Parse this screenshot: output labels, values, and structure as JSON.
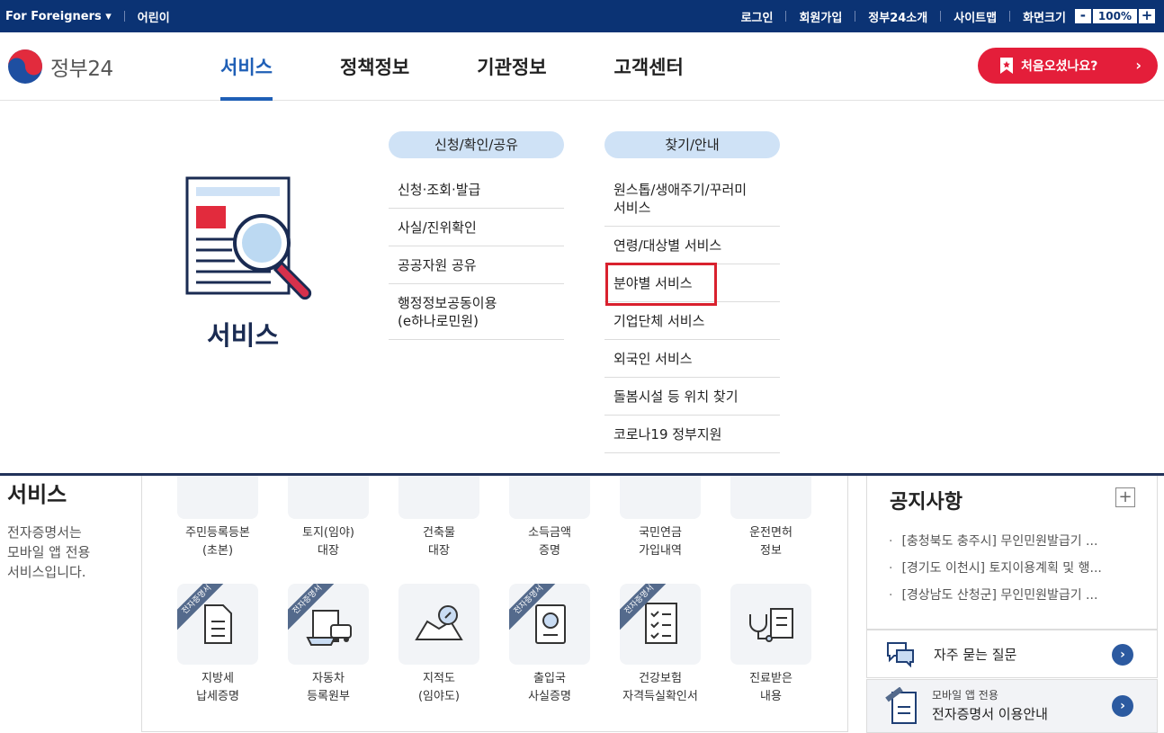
{
  "topbar": {
    "for_foreigners": "For Foreigners ▾",
    "kids": "어린이",
    "login": "로그인",
    "signup": "회원가입",
    "about": "정부24소개",
    "sitemap": "사이트맵",
    "zoom_label": "화면크기",
    "zoom_minus": "-",
    "zoom_value": "100%",
    "zoom_plus": "+"
  },
  "header": {
    "logo_text": "정부24",
    "nav": [
      "서비스",
      "정책정보",
      "기관정보",
      "고객센터"
    ],
    "first_visit": "처음오셨나요?",
    "first_visit_arrow": "›"
  },
  "dropdown": {
    "title": "서비스",
    "col1": {
      "heading": "신청/확인/공유",
      "items": [
        "신청·조회·발급",
        "사실/진위확인",
        "공공자원 공유",
        "행정정보공동이용\n(e하나로민원)"
      ]
    },
    "col2": {
      "heading": "찾기/안내",
      "items": [
        "원스톱/생애주기/꾸러미\n서비스",
        "연령/대상별 서비스",
        "분야별 서비스",
        "기업단체 서비스",
        "외국인 서비스",
        "돌봄시설 등 위치 찾기",
        "코로나19 정부지원"
      ]
    }
  },
  "side": {
    "title": "서비스",
    "desc": "전자증명서는\n모바일 앱 전용\n서비스입니다."
  },
  "grid": {
    "ribbon": "전자증명서",
    "row1": [
      "주민등록등본\n(초본)",
      "토지(임야)\n대장",
      "건축물\n대장",
      "소득금액\n증명",
      "국민연금\n가입내역",
      "운전면허\n정보"
    ],
    "row2": [
      "지방세\n납세증명",
      "자동차\n등록원부",
      "지적도\n(임야도)",
      "출입국\n사실증명",
      "건강보험\n자격득실확인서",
      "진료받은\n내용"
    ]
  },
  "notice": {
    "title": "공지사항",
    "plus": "+",
    "items": [
      "[충청북도 충주시] 무인민원발급기 ...",
      "[경기도 이천시] 토지이용계획 및 행...",
      "[경상남도 산청군] 무인민원발급기 ..."
    ]
  },
  "faq": {
    "label": "자주 묻는 질문",
    "arrow": "›"
  },
  "mobile": {
    "sub": "모바일 앱 전용",
    "main": "전자증명서 이용안내",
    "arrow": "›"
  },
  "colors": {
    "navy": "#0b3374",
    "accent_blue": "#1f5fb6",
    "red": "#e41e3a",
    "pill": "#cfe2f6",
    "highlight": "#d9212e"
  }
}
